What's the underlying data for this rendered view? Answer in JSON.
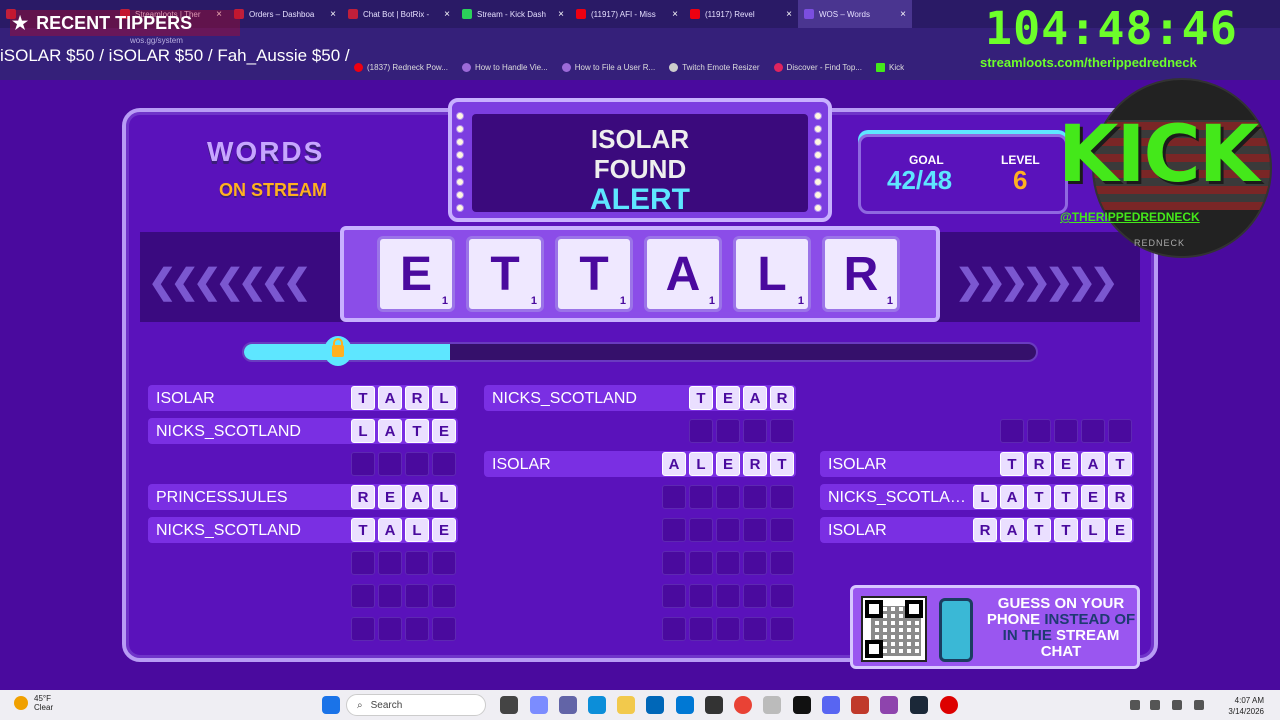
{
  "browser": {
    "tabs": [
      {
        "label": ""
      },
      {
        "label": "Streamloots | Ther"
      },
      {
        "label": "Orders – Dashboa"
      },
      {
        "label": "Chat Bot | BotRix -"
      },
      {
        "label": "Stream - Kick Dash"
      },
      {
        "label": "(11917) AFI - Miss"
      },
      {
        "label": "(11917) Revel"
      },
      {
        "label": "WOS – Words"
      },
      {
        "label": ""
      }
    ],
    "address": "wos.gg/system",
    "bookmarks": [
      {
        "label": "(1837) Redneck Pow..."
      },
      {
        "label": "How to Handle Vie..."
      },
      {
        "label": "How to File a User R..."
      },
      {
        "label": "Twitch Emote Resizer"
      },
      {
        "label": "Discover - Find Top..."
      },
      {
        "label": "Kick"
      }
    ]
  },
  "overlay": {
    "tippers_title": "RECENT TIPPERS",
    "tippers_ticker": "iSOLAR $50 / iSOLAR $50 / Fah_Aussie $50 /",
    "timer": "104:48:46",
    "streamloots_url": "streamloots.com/therippedredneck",
    "kick_logo": "KICK",
    "kick_handle": "@THERIPPEDREDNECK",
    "kick_sub": "REDNECK"
  },
  "game": {
    "logo_words": "WORDS",
    "logo_on": "ON STREAM",
    "alert_line1": "ISOLAR",
    "alert_line2": "FOUND",
    "alert_line3": "ALERT",
    "letters": [
      {
        "ch": "E",
        "pts": "1"
      },
      {
        "ch": "T",
        "pts": "1"
      },
      {
        "ch": "T",
        "pts": "1"
      },
      {
        "ch": "A",
        "pts": "1"
      },
      {
        "ch": "L",
        "pts": "1"
      },
      {
        "ch": "R",
        "pts": "1"
      }
    ],
    "progress_fraction": 0.26,
    "goal_label": "GOAL",
    "goal_value": "42/48",
    "level_label": "LEVEL",
    "level_value": "6",
    "columns": [
      [
        {
          "name": "ISOLAR",
          "letters": [
            "T",
            "A",
            "R",
            "L"
          ]
        },
        {
          "name": "NICKS_SCOTLAND",
          "letters": [
            "L",
            "A",
            "T",
            "E"
          ]
        },
        {
          "name": "",
          "letters": [
            "",
            "",
            "",
            ""
          ]
        },
        {
          "name": "PRINCESSJULES",
          "letters": [
            "R",
            "E",
            "A",
            "L"
          ]
        },
        {
          "name": "NICKS_SCOTLAND",
          "letters": [
            "T",
            "A",
            "L",
            "E"
          ]
        },
        {
          "name": "",
          "letters": [
            "",
            "",
            "",
            ""
          ]
        },
        {
          "name": "",
          "letters": [
            "",
            "",
            "",
            ""
          ]
        },
        {
          "name": "",
          "letters": [
            "",
            "",
            "",
            ""
          ]
        }
      ],
      [
        {
          "name": "NICKS_SCOTLAND",
          "letters": [
            "T",
            "E",
            "A",
            "R"
          ]
        },
        {
          "name": "",
          "letters": [
            "",
            "",
            "",
            ""
          ]
        },
        {
          "name": "ISOLAR",
          "letters": [
            "A",
            "L",
            "E",
            "R",
            "T"
          ]
        },
        {
          "name": "",
          "letters": [
            "",
            "",
            "",
            "",
            ""
          ]
        },
        {
          "name": "",
          "letters": [
            "",
            "",
            "",
            "",
            ""
          ]
        },
        {
          "name": "",
          "letters": [
            "",
            "",
            "",
            "",
            ""
          ]
        },
        {
          "name": "",
          "letters": [
            "",
            "",
            "",
            "",
            ""
          ]
        },
        {
          "name": "",
          "letters": [
            "",
            "",
            "",
            "",
            ""
          ]
        }
      ],
      [
        {
          "name": "",
          "letters": [
            "",
            "",
            "",
            "",
            ""
          ]
        },
        {
          "name": "ISOLAR",
          "letters": [
            "T",
            "R",
            "E",
            "A",
            "T"
          ]
        },
        {
          "name": "NICKS_SCOTLA…",
          "letters": [
            "L",
            "A",
            "T",
            "T",
            "E",
            "R"
          ]
        },
        {
          "name": "ISOLAR",
          "letters": [
            "R",
            "A",
            "T",
            "T",
            "L",
            "E"
          ]
        }
      ]
    ],
    "qr_text_a": "GUESS ON YOUR PHONE",
    "qr_text_b": "INSTEAD OF IN THE",
    "qr_text_c": "STREAM CHAT"
  },
  "taskbar": {
    "weather_temp": "45°F",
    "weather_desc": "Clear",
    "search_placeholder": "Search",
    "time": "4:07 AM",
    "date": "3/14/2026"
  },
  "colors": {
    "accent": "#5ee6ff",
    "board": "#5a12bb",
    "kick_green": "#44e81a",
    "timer_green": "#6dff2a"
  }
}
